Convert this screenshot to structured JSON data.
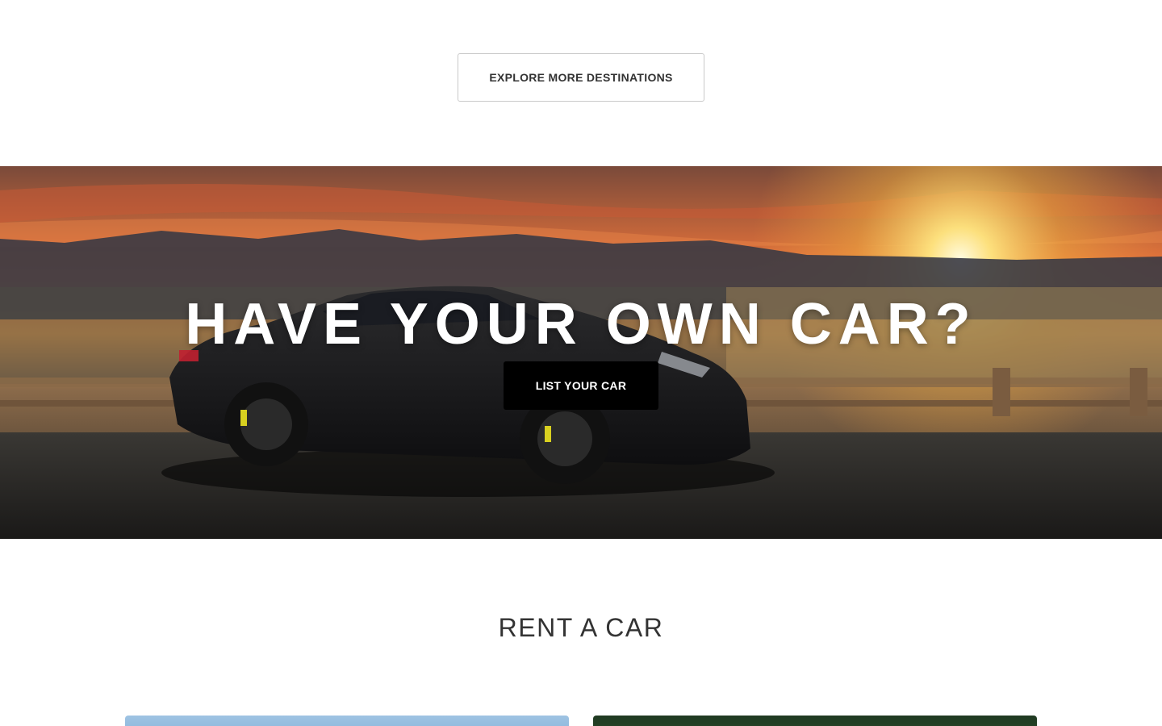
{
  "explore": {
    "button_label": "EXPLORE MORE DESTINATIONS"
  },
  "hero": {
    "title": "HAVE YOUR OWN CAR?",
    "cta_label": "LIST YOUR CAR"
  },
  "rent": {
    "title": "RENT A CAR"
  },
  "colors": {
    "cta_background": "#000000",
    "heading_text": "#333333",
    "button_border": "#c9c9c9"
  }
}
